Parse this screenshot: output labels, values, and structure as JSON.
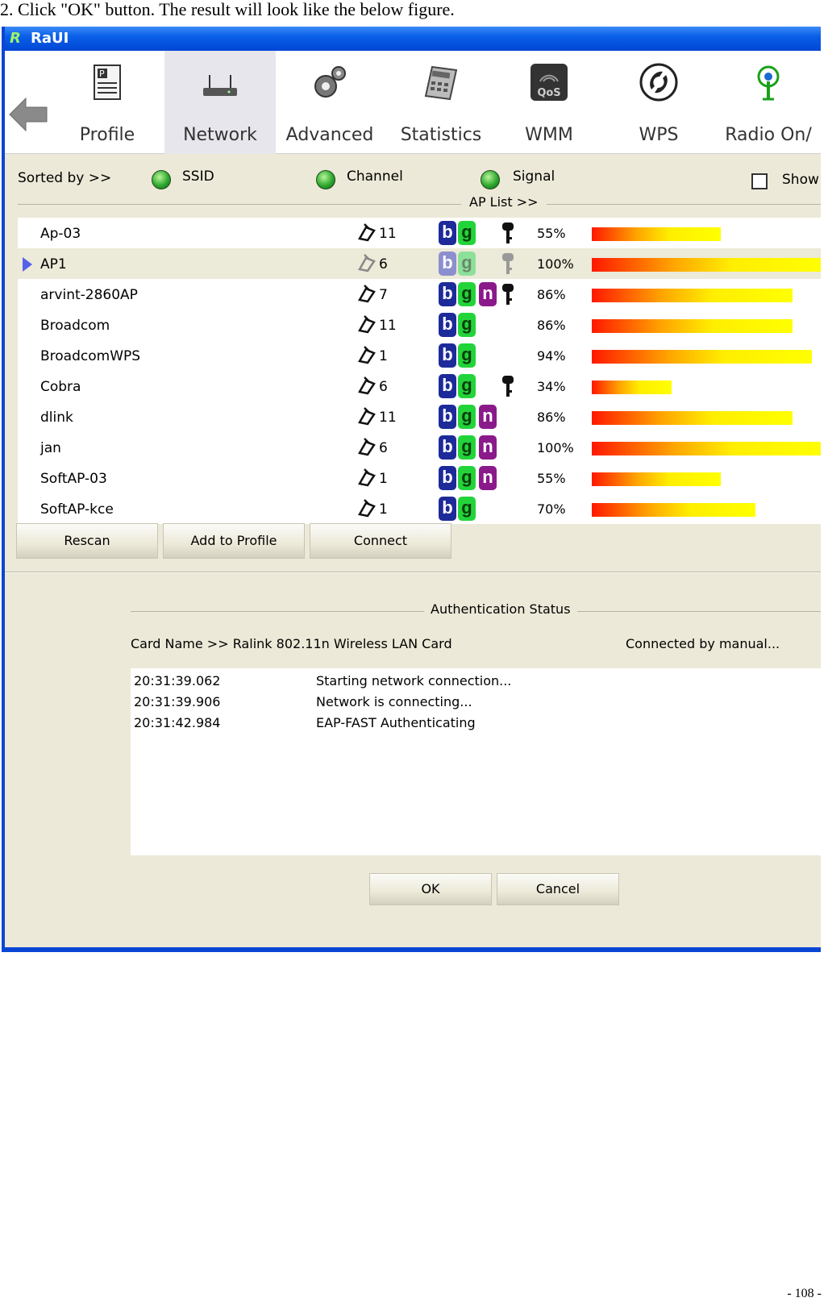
{
  "caption": "2. Click \"OK\" button. The result will look like the below figure.",
  "page_number": "- 108 -",
  "window": {
    "title": "RaUI"
  },
  "toolbar": {
    "items": [
      {
        "label": "Profile",
        "icon": "profile-icon"
      },
      {
        "label": "Network",
        "icon": "network-icon",
        "active": true
      },
      {
        "label": "Advanced",
        "icon": "advanced-icon"
      },
      {
        "label": "Statistics",
        "icon": "statistics-icon"
      },
      {
        "label": "WMM",
        "icon": "wmm-icon"
      },
      {
        "label": "WPS",
        "icon": "wps-icon"
      },
      {
        "label": "Radio On/",
        "icon": "radio-icon"
      }
    ]
  },
  "sort": {
    "label": "Sorted by >>",
    "options": [
      "SSID",
      "Channel",
      "Signal"
    ],
    "show_label": "Show"
  },
  "ap_list": {
    "label": "AP List >>",
    "rows": [
      {
        "ssid": "Ap-03",
        "channel": "11",
        "modes": [
          "b",
          "g"
        ],
        "secured": true,
        "signal": "55%",
        "level": 0.55
      },
      {
        "ssid": "AP1",
        "channel": "6",
        "modes": [
          "b",
          "g"
        ],
        "secured": true,
        "signal": "100%",
        "level": 1.0,
        "selected": true
      },
      {
        "ssid": "arvint-2860AP",
        "channel": "7",
        "modes": [
          "b",
          "g",
          "n"
        ],
        "secured": true,
        "signal": "86%",
        "level": 0.86
      },
      {
        "ssid": "Broadcom",
        "channel": "11",
        "modes": [
          "b",
          "g"
        ],
        "secured": false,
        "signal": "86%",
        "level": 0.86
      },
      {
        "ssid": "BroadcomWPS",
        "channel": "1",
        "modes": [
          "b",
          "g"
        ],
        "secured": false,
        "signal": "94%",
        "level": 0.94
      },
      {
        "ssid": "Cobra",
        "channel": "6",
        "modes": [
          "b",
          "g"
        ],
        "secured": true,
        "signal": "34%",
        "level": 0.34
      },
      {
        "ssid": "dlink",
        "channel": "11",
        "modes": [
          "b",
          "g",
          "n"
        ],
        "secured": false,
        "signal": "86%",
        "level": 0.86
      },
      {
        "ssid": "jan",
        "channel": "6",
        "modes": [
          "b",
          "g",
          "n"
        ],
        "secured": false,
        "signal": "100%",
        "level": 1.0
      },
      {
        "ssid": "SoftAP-03",
        "channel": "1",
        "modes": [
          "b",
          "g",
          "n"
        ],
        "secured": false,
        "signal": "55%",
        "level": 0.55
      },
      {
        "ssid": "SoftAP-kce",
        "channel": "1",
        "modes": [
          "b",
          "g"
        ],
        "secured": false,
        "signal": "70%",
        "level": 0.7
      }
    ]
  },
  "actions": {
    "rescan": "Rescan",
    "add_profile": "Add to Profile",
    "connect": "Connect"
  },
  "auth": {
    "label": "Authentication Status",
    "card_name": "Card Name >> Ralink 802.11n Wireless LAN Card",
    "connected_by": "Connected by manual...",
    "log": [
      {
        "time": "20:31:39.062",
        "message": "Starting network connection..."
      },
      {
        "time": "20:31:39.906",
        "message": "Network is connecting..."
      },
      {
        "time": "20:31:42.984",
        "message": "EAP-FAST Authenticating"
      }
    ]
  },
  "dialog": {
    "ok": "OK",
    "cancel": "Cancel"
  },
  "colors": {
    "titlebar": "#0a46d6",
    "window_bg": "#ece9d8",
    "selected_row": "#ecead8"
  }
}
